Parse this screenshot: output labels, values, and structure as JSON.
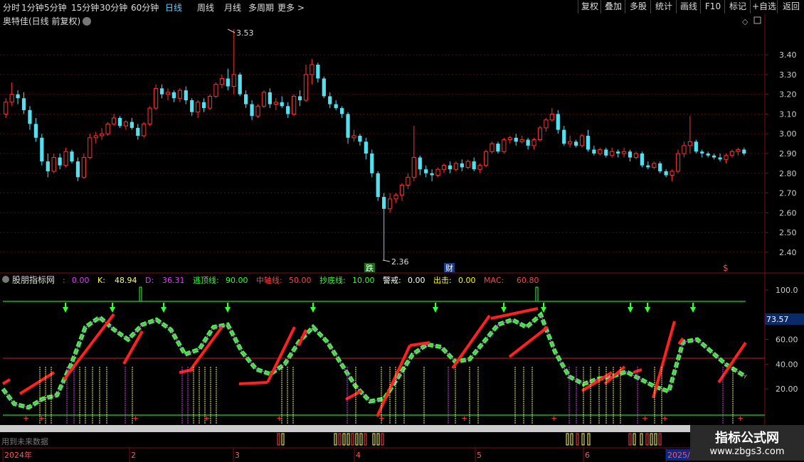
{
  "toolbar": {
    "periods": [
      "分时",
      "1分钟",
      "5分钟",
      "15分钟",
      "30分钟",
      "60分钟",
      "日线",
      "周线",
      "月线",
      "多周期",
      "更多 >"
    ],
    "active_index": 6,
    "right_buttons": [
      "复权",
      "叠加",
      "多股",
      "统计",
      "画线",
      "F10",
      "标记",
      "+自选",
      "返回"
    ]
  },
  "main_chart": {
    "title": "奥特佳(日线 前复权)",
    "high_label": "3.53",
    "low_label": "2.36",
    "markers": [
      "跌",
      "财",
      "$"
    ],
    "y_ticks": [
      "3.40",
      "3.30",
      "3.20",
      "3.10",
      "3.00",
      "2.90",
      "2.80",
      "2.70",
      "2.60",
      "2.50",
      "2.40"
    ]
  },
  "indicator": {
    "name": "股朋指标网",
    "params": [
      {
        "label": ":",
        "value": "0.00",
        "color": "#e040fb"
      },
      {
        "label": "K:",
        "value": "48.94",
        "color": "#ffff66"
      },
      {
        "label": "D:",
        "value": "36.31",
        "color": "#e040fb"
      },
      {
        "label": "逃顶线:",
        "value": "90.00",
        "color": "#33ff33"
      },
      {
        "label": "中轴线:",
        "value": "50.00",
        "color": "#ff4444"
      },
      {
        "label": "抄底线:",
        "value": "10.00",
        "color": "#33ff33"
      },
      {
        "label": "警戒:",
        "value": "0.00",
        "color": "#ffffff"
      },
      {
        "label": "出击:",
        "value": "0.00",
        "color": "#ffff00"
      },
      {
        "label": "MAC:",
        "value": "60.80",
        "color": "#ff4444"
      }
    ],
    "y_ticks": [
      "100.0",
      "60.00",
      "40.00",
      "20.00"
    ],
    "current_value": "73.57"
  },
  "timeline": {
    "labels": [
      "2024年",
      "2",
      "3",
      "4",
      "5",
      "6",
      "2025/0"
    ],
    "note": "用到未来数据"
  },
  "watermark": {
    "title": "指标公式网",
    "url": "www.zbgs3.com"
  },
  "colors": {
    "up": "#ff3333",
    "down": "#55e0f0",
    "grid": "#7a1010",
    "accent": "#6cf"
  },
  "chart_data": {
    "type": "candlestick",
    "ylim": [
      2.36,
      3.53
    ],
    "ohlc": [
      [
        3.1,
        3.18,
        3.08,
        3.16
      ],
      [
        3.16,
        3.26,
        3.14,
        3.2
      ],
      [
        3.2,
        3.22,
        3.15,
        3.18
      ],
      [
        3.18,
        3.21,
        3.1,
        3.12
      ],
      [
        3.12,
        3.14,
        3.02,
        3.05
      ],
      [
        3.05,
        3.08,
        2.96,
        2.98
      ],
      [
        2.98,
        3.0,
        2.84,
        2.86
      ],
      [
        2.86,
        2.9,
        2.78,
        2.81
      ],
      [
        2.81,
        2.9,
        2.8,
        2.88
      ],
      [
        2.88,
        2.9,
        2.82,
        2.84
      ],
      [
        2.84,
        2.93,
        2.83,
        2.91
      ],
      [
        2.91,
        2.92,
        2.85,
        2.86
      ],
      [
        2.86,
        2.88,
        2.76,
        2.78
      ],
      [
        2.78,
        2.9,
        2.77,
        2.88
      ],
      [
        2.88,
        3.0,
        2.87,
        2.98
      ],
      [
        2.98,
        3.01,
        2.95,
        2.99
      ],
      [
        2.99,
        3.03,
        2.97,
        3.0
      ],
      [
        3.0,
        3.06,
        2.99,
        3.05
      ],
      [
        3.05,
        3.1,
        3.04,
        3.08
      ],
      [
        3.08,
        3.09,
        3.03,
        3.04
      ],
      [
        3.04,
        3.07,
        3.02,
        3.06
      ],
      [
        3.06,
        3.08,
        3.02,
        3.03
      ],
      [
        3.03,
        3.05,
        2.97,
        2.99
      ],
      [
        2.99,
        3.06,
        2.98,
        3.05
      ],
      [
        3.05,
        3.14,
        3.04,
        3.13
      ],
      [
        3.13,
        3.25,
        3.12,
        3.23
      ],
      [
        3.23,
        3.25,
        3.18,
        3.2
      ],
      [
        3.2,
        3.23,
        3.17,
        3.21
      ],
      [
        3.21,
        3.22,
        3.16,
        3.18
      ],
      [
        3.18,
        3.23,
        3.16,
        3.22
      ],
      [
        3.22,
        3.24,
        3.15,
        3.17
      ],
      [
        3.17,
        3.18,
        3.09,
        3.11
      ],
      [
        3.11,
        3.17,
        3.08,
        3.16
      ],
      [
        3.16,
        3.18,
        3.11,
        3.13
      ],
      [
        3.13,
        3.2,
        3.12,
        3.19
      ],
      [
        3.19,
        3.26,
        3.18,
        3.25
      ],
      [
        3.25,
        3.3,
        3.23,
        3.28
      ],
      [
        3.28,
        3.33,
        3.22,
        3.24
      ],
      [
        3.24,
        3.53,
        3.2,
        3.3
      ],
      [
        3.3,
        3.31,
        3.19,
        3.2
      ],
      [
        3.2,
        3.22,
        3.13,
        3.15
      ],
      [
        3.15,
        3.17,
        3.07,
        3.09
      ],
      [
        3.09,
        3.15,
        3.08,
        3.14
      ],
      [
        3.14,
        3.22,
        3.13,
        3.21
      ],
      [
        3.21,
        3.23,
        3.13,
        3.15
      ],
      [
        3.15,
        3.18,
        3.12,
        3.16
      ],
      [
        3.16,
        3.19,
        3.13,
        3.14
      ],
      [
        3.14,
        3.16,
        3.08,
        3.1
      ],
      [
        3.1,
        3.2,
        3.09,
        3.19
      ],
      [
        3.19,
        3.22,
        3.14,
        3.17
      ],
      [
        3.17,
        3.35,
        3.16,
        3.3
      ],
      [
        3.3,
        3.38,
        3.25,
        3.35
      ],
      [
        3.35,
        3.36,
        3.26,
        3.28
      ],
      [
        3.28,
        3.29,
        3.18,
        3.19
      ],
      [
        3.19,
        3.21,
        3.13,
        3.15
      ],
      [
        3.15,
        3.17,
        3.12,
        3.13
      ],
      [
        3.13,
        3.14,
        3.08,
        3.1
      ],
      [
        3.1,
        3.11,
        2.95,
        2.98
      ],
      [
        2.98,
        3.02,
        2.96,
        2.99
      ],
      [
        2.99,
        3.0,
        2.94,
        2.96
      ],
      [
        2.96,
        2.98,
        2.87,
        2.9
      ],
      [
        2.9,
        2.92,
        2.78,
        2.8
      ],
      [
        2.8,
        2.81,
        2.66,
        2.68
      ],
      [
        2.68,
        2.7,
        2.36,
        2.62
      ],
      [
        2.62,
        2.7,
        2.6,
        2.67
      ],
      [
        2.67,
        2.7,
        2.65,
        2.69
      ],
      [
        2.69,
        2.75,
        2.66,
        2.74
      ],
      [
        2.74,
        2.8,
        2.72,
        2.78
      ],
      [
        2.78,
        3.04,
        2.76,
        2.88
      ],
      [
        2.88,
        2.89,
        2.79,
        2.82
      ],
      [
        2.82,
        2.84,
        2.78,
        2.8
      ],
      [
        2.8,
        2.82,
        2.76,
        2.79
      ],
      [
        2.79,
        2.83,
        2.78,
        2.82
      ],
      [
        2.82,
        2.85,
        2.8,
        2.84
      ],
      [
        2.84,
        2.86,
        2.8,
        2.82
      ],
      [
        2.82,
        2.86,
        2.81,
        2.85
      ],
      [
        2.85,
        2.87,
        2.81,
        2.83
      ],
      [
        2.83,
        2.87,
        2.82,
        2.86
      ],
      [
        2.86,
        2.88,
        2.81,
        2.82
      ],
      [
        2.82,
        2.85,
        2.8,
        2.84
      ],
      [
        2.84,
        2.92,
        2.83,
        2.91
      ],
      [
        2.91,
        2.96,
        2.9,
        2.95
      ],
      [
        2.95,
        2.96,
        2.9,
        2.91
      ],
      [
        2.91,
        2.98,
        2.9,
        2.97
      ],
      [
        2.97,
        2.99,
        2.95,
        2.98
      ],
      [
        2.98,
        3.0,
        2.94,
        2.96
      ],
      [
        2.96,
        2.99,
        2.95,
        2.97
      ],
      [
        2.97,
        2.98,
        2.92,
        2.94
      ],
      [
        2.94,
        2.98,
        2.92,
        2.97
      ],
      [
        2.97,
        3.04,
        2.96,
        3.03
      ],
      [
        3.03,
        3.08,
        3.01,
        3.07
      ],
      [
        3.07,
        3.13,
        3.06,
        3.1
      ],
      [
        3.1,
        3.12,
        3.0,
        3.02
      ],
      [
        3.02,
        3.04,
        2.94,
        2.95
      ],
      [
        2.95,
        2.99,
        2.93,
        2.96
      ],
      [
        2.96,
        2.97,
        2.93,
        2.94
      ],
      [
        2.94,
        3.0,
        2.93,
        2.99
      ],
      [
        2.99,
        3.02,
        2.91,
        2.92
      ],
      [
        2.92,
        2.94,
        2.89,
        2.9
      ],
      [
        2.9,
        2.93,
        2.89,
        2.92
      ],
      [
        2.92,
        2.93,
        2.88,
        2.89
      ],
      [
        2.89,
        2.93,
        2.88,
        2.91
      ],
      [
        2.91,
        2.92,
        2.88,
        2.9
      ],
      [
        2.9,
        2.93,
        2.88,
        2.91
      ],
      [
        2.91,
        2.92,
        2.86,
        2.88
      ],
      [
        2.88,
        2.91,
        2.87,
        2.9
      ],
      [
        2.9,
        2.91,
        2.83,
        2.84
      ],
      [
        2.84,
        2.86,
        2.82,
        2.83
      ],
      [
        2.83,
        2.86,
        2.82,
        2.85
      ],
      [
        2.85,
        2.86,
        2.8,
        2.81
      ],
      [
        2.81,
        2.82,
        2.78,
        2.79
      ],
      [
        2.79,
        2.82,
        2.76,
        2.81
      ],
      [
        2.81,
        2.92,
        2.8,
        2.9
      ],
      [
        2.9,
        2.96,
        2.88,
        2.94
      ],
      [
        2.94,
        3.09,
        2.9,
        2.96
      ],
      [
        2.96,
        2.97,
        2.9,
        2.91
      ],
      [
        2.91,
        2.92,
        2.88,
        2.9
      ],
      [
        2.9,
        2.91,
        2.88,
        2.89
      ],
      [
        2.89,
        2.9,
        2.87,
        2.88
      ],
      [
        2.88,
        2.9,
        2.86,
        2.87
      ],
      [
        2.87,
        2.9,
        2.85,
        2.89
      ],
      [
        2.89,
        2.92,
        2.88,
        2.91
      ],
      [
        2.91,
        2.93,
        2.89,
        2.92
      ],
      [
        2.92,
        2.93,
        2.89,
        2.9
      ]
    ]
  }
}
